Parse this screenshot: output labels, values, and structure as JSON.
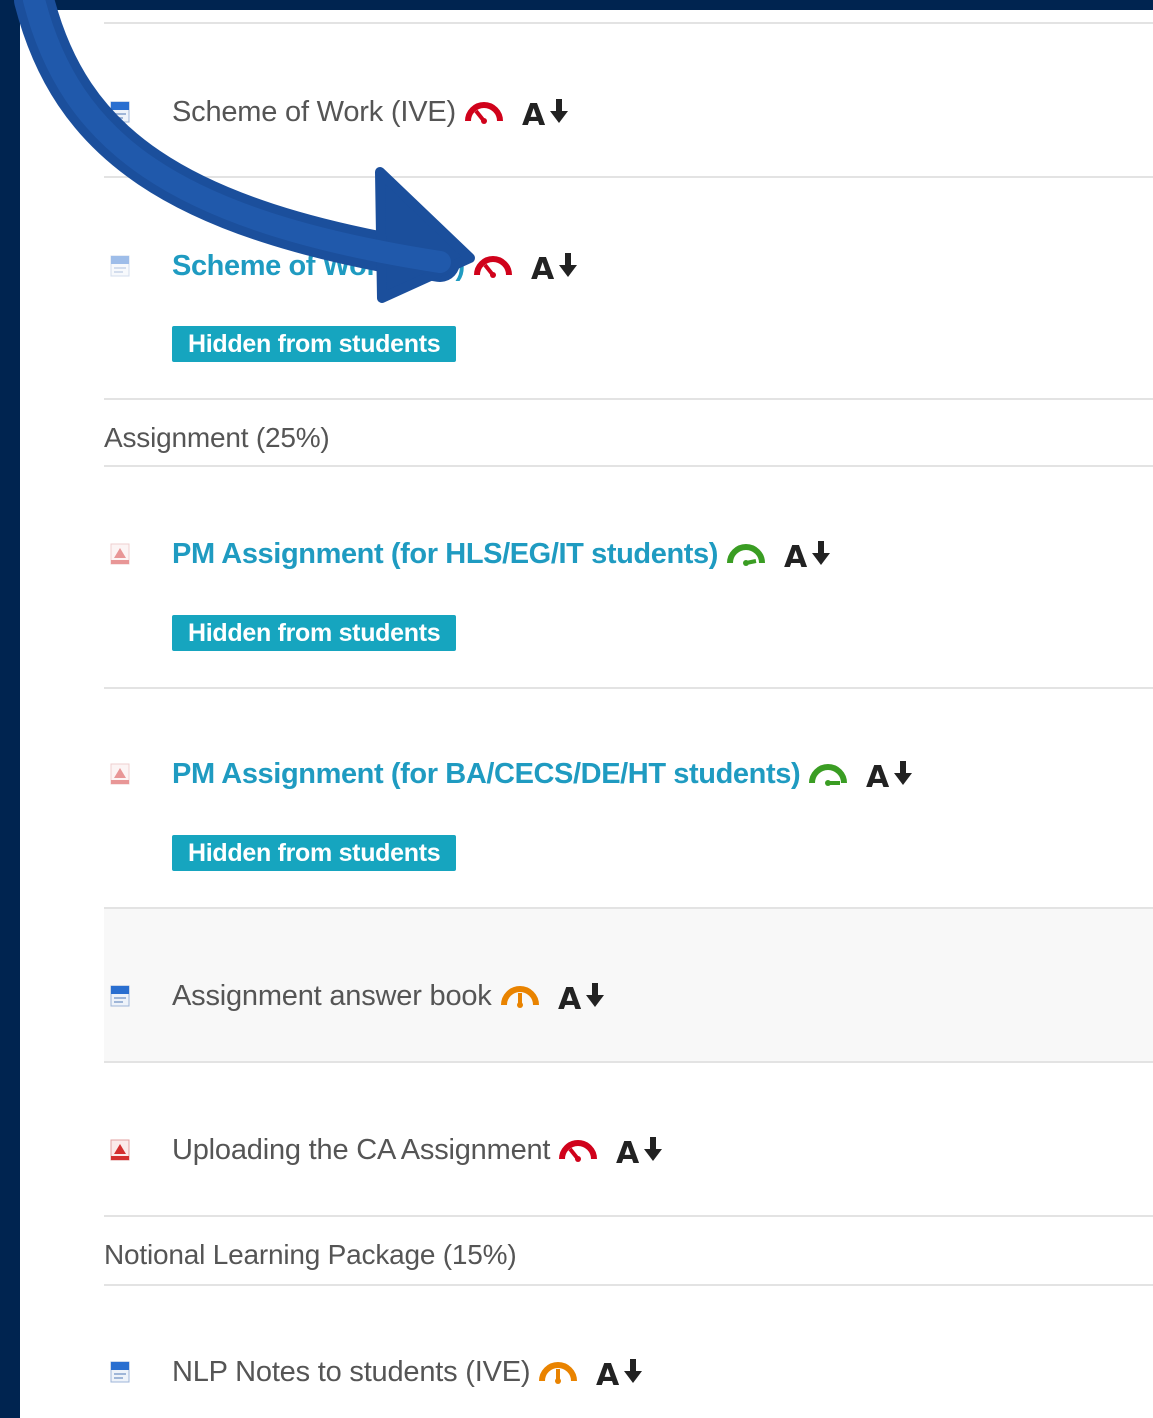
{
  "course": {
    "items": [
      {
        "title": "Scheme of Work (IVE)",
        "type": "word",
        "style": "plain",
        "gauge": "red",
        "badge": null
      },
      {
        "title": "Scheme of Work (IVE)",
        "type": "word",
        "style": "link-muted",
        "gauge": "red",
        "badge": "Hidden from students"
      },
      {
        "title": "PM Assignment (for HLS/EG/IT students)",
        "type": "pdf",
        "style": "link",
        "gauge": "green",
        "badge": "Hidden from students"
      },
      {
        "title": "PM Assignment (for BA/CECS/DE/HT students)",
        "type": "pdf",
        "style": "link",
        "gauge": "green",
        "badge": "Hidden from students"
      },
      {
        "title": "Assignment answer book",
        "type": "word",
        "style": "plain",
        "gauge": "orange",
        "badge": null
      },
      {
        "title": "Uploading the CA Assignment",
        "type": "pdf",
        "style": "plain",
        "gauge": "red",
        "badge": null
      },
      {
        "title": "NLP Notes to students (IVE)",
        "type": "word",
        "style": "plain",
        "gauge": "orange",
        "badge": null
      }
    ],
    "sections": [
      {
        "label": "Assignment (25%)"
      },
      {
        "label": "Notional Learning Package (15%)"
      }
    ]
  },
  "icons": {
    "word_file": "word-document-icon",
    "pdf_file": "pdf-document-icon",
    "gauge": "accessibility-score-gauge-icon",
    "alternative_formats": "alternative-formats-icon",
    "arrow": "curved-arrow-annotation"
  },
  "colors": {
    "background": "#002450",
    "link": "#1f9bc1",
    "badge": "#16a5bf",
    "gauge_red": "#d0021b",
    "gauge_orange": "#e98300",
    "gauge_green": "#3a9d23",
    "arrow": "#1b4f9c"
  }
}
